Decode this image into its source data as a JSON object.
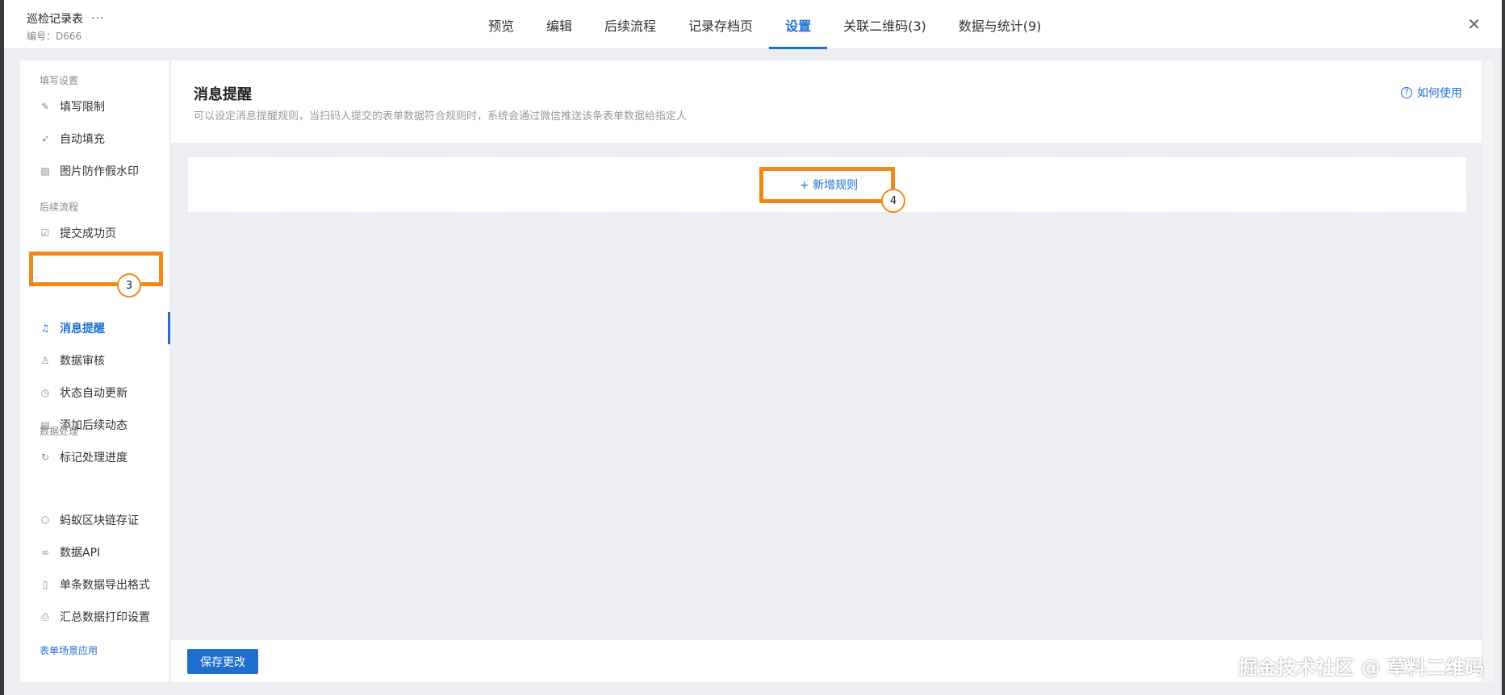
{
  "header": {
    "doc_title": "巡检记录表",
    "more": "···",
    "doc_id": "编号：D666",
    "tabs": [
      {
        "label": "预览"
      },
      {
        "label": "编辑"
      },
      {
        "label": "后续流程"
      },
      {
        "label": "记录存档页"
      },
      {
        "label": "设置",
        "active": true
      },
      {
        "label": "关联二维码(3)"
      },
      {
        "label": "数据与统计(9)"
      }
    ],
    "close": "✕"
  },
  "sidebar": {
    "groups": [
      "填写设置",
      "后续流程",
      "数据处理"
    ],
    "items": [
      {
        "label": "填写限制",
        "icon": "edit-icon"
      },
      {
        "label": "自动填充",
        "icon": "rocket-icon"
      },
      {
        "label": "图片防作假水印",
        "icon": "image-icon"
      },
      {
        "label": "提交成功页",
        "icon": "check-doc-icon"
      },
      {
        "label": "消息提醒",
        "icon": "bell-icon",
        "active": true
      },
      {
        "label": "数据审核",
        "icon": "stamp-icon"
      },
      {
        "label": "状态自动更新",
        "icon": "clock-icon"
      },
      {
        "label": "添加后续动态",
        "icon": "list-doc-icon"
      },
      {
        "label": "标记处理进度",
        "icon": "refresh-icon"
      },
      {
        "label": "蚂蚁区块链存证",
        "icon": "blockchain-icon"
      },
      {
        "label": "数据API",
        "icon": "link-icon"
      },
      {
        "label": "单条数据导出格式",
        "icon": "file-icon"
      },
      {
        "label": "汇总数据打印设置",
        "icon": "printer-icon"
      }
    ],
    "scene_link": "表单场景应用"
  },
  "main": {
    "title": "消息提醒",
    "description": "可以设定消息提醒规则，当扫码人提交的表单数据符合规则时，系统会通过微信推送该条表单数据给指定人",
    "help": "如何使用",
    "add_rule": "+ 新增规则",
    "save": "保存更改"
  },
  "annotations": {
    "step3": "3",
    "step4": "4",
    "watermark": "掘金技术社区 @ 草料二维码"
  },
  "colors": {
    "accent": "#1f6fd1",
    "highlight": "#f0891a"
  }
}
